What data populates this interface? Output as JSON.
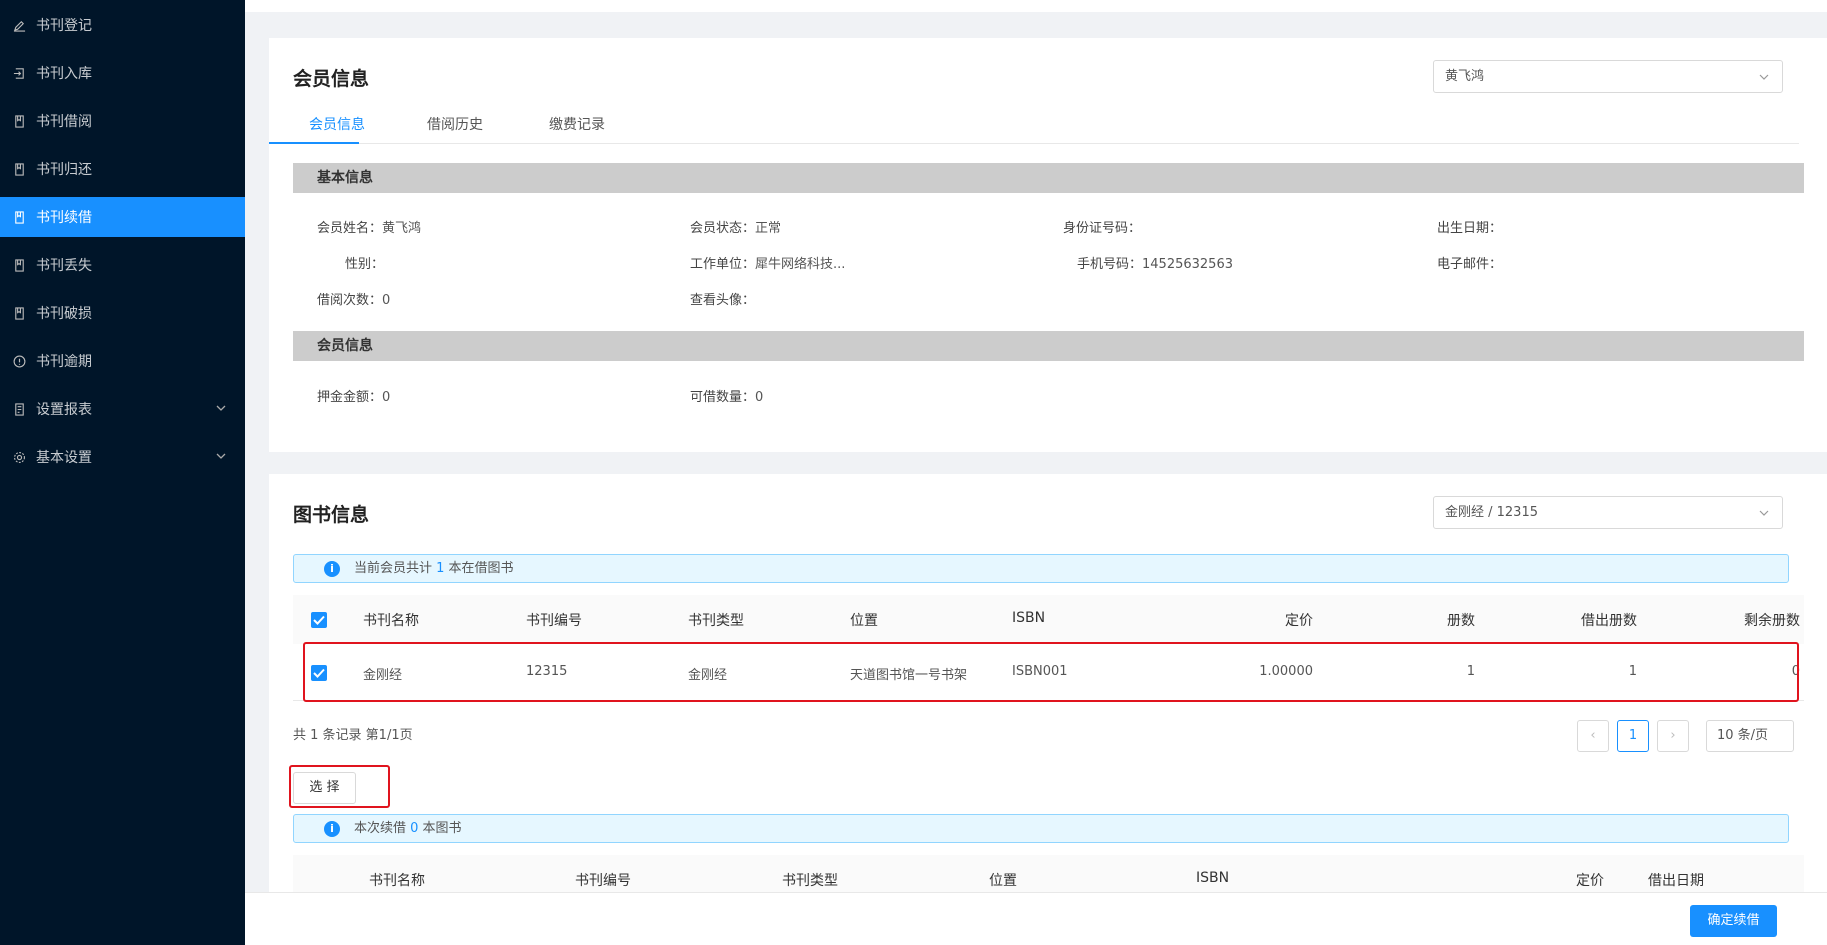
{
  "sidebar": {
    "items": [
      {
        "label": "书刊登记",
        "icon": "edit-icon"
      },
      {
        "label": "书刊入库",
        "icon": "import-icon"
      },
      {
        "label": "书刊借阅",
        "icon": "book-icon"
      },
      {
        "label": "书刊归还",
        "icon": "book-icon"
      },
      {
        "label": "书刊续借",
        "icon": "book-icon",
        "active": true
      },
      {
        "label": "书刊丢失",
        "icon": "book-icon"
      },
      {
        "label": "书刊破损",
        "icon": "book-icon"
      },
      {
        "label": "书刊逾期",
        "icon": "info-circle-icon"
      },
      {
        "label": "设置报表",
        "icon": "report-icon",
        "expandable": true
      },
      {
        "label": "基本设置",
        "icon": "gear-icon",
        "expandable": true
      }
    ]
  },
  "member_card": {
    "title": "会员信息",
    "member_select": "黄飞鸿",
    "tabs": [
      "会员信息",
      "借阅历史",
      "缴费记录"
    ],
    "basic_section": "基本信息",
    "fields": {
      "name": {
        "label": "会员姓名：",
        "value": "黄飞鸿"
      },
      "status": {
        "label": "会员状态：",
        "value": "正常"
      },
      "id_number": {
        "label": "身份证号码：",
        "value": ""
      },
      "birth": {
        "label": "出生日期：",
        "value": ""
      },
      "gender": {
        "label": "性别：",
        "value": ""
      },
      "employer": {
        "label": "工作单位：",
        "value": "犀牛网络科技..."
      },
      "phone": {
        "label": "手机号码：",
        "value": "14525632563"
      },
      "email": {
        "label": "电子邮件：",
        "value": ""
      },
      "borrow_count": {
        "label": "借阅次数：",
        "value": "0"
      },
      "avatar": {
        "label": "查看头像：",
        "value": ""
      }
    },
    "member_section": "会员信息",
    "member_fields": {
      "deposit": {
        "label": "押金金额：",
        "value": "0"
      },
      "borrowable": {
        "label": "可借数量：",
        "value": "0"
      }
    }
  },
  "book_card": {
    "title": "图书信息",
    "book_select": "金刚经 / 12315",
    "alert1": {
      "pre": "当前会员共计 ",
      "num": "1",
      "post": " 本在借图书"
    },
    "columns": [
      "书刊名称",
      "书刊编号",
      "书刊类型",
      "位置",
      "ISBN",
      "定价",
      "册数",
      "借出册数",
      "剩余册数"
    ],
    "rows": [
      {
        "name": "金刚经",
        "code": "12315",
        "type": "金刚经",
        "location": "天道图书馆一号书架",
        "isbn": "ISBN001",
        "price": "1.00000",
        "count": "1",
        "lent": "1",
        "remaining": "0"
      }
    ],
    "page_info": "共 1 条记录 第1/1页",
    "current_page": "1",
    "page_size": "10 条/页",
    "select_button": "选 择",
    "alert2": {
      "pre": "本次续借 ",
      "num": "0",
      "post": " 本图书"
    },
    "columns2": [
      "书刊名称",
      "书刊编号",
      "书刊类型",
      "位置",
      "ISBN",
      "定价",
      "借出日期"
    ]
  },
  "footer": {
    "confirm_button": "确定续借"
  },
  "colors": {
    "primary": "#1890ff",
    "sidebar": "#001529",
    "highlight": "#e0141e"
  }
}
